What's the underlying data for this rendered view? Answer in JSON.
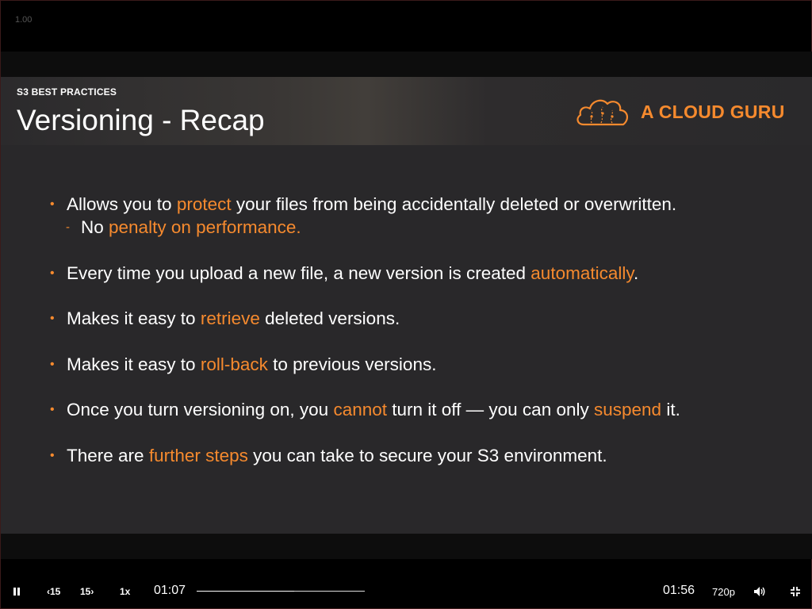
{
  "player": {
    "zoom_level": "1.00"
  },
  "slide": {
    "section_label": "S3 BEST PRACTICES",
    "title": "Versioning - Recap",
    "logo_text": "A CLOUD GURU",
    "bullets": [
      {
        "parts": [
          "Allows you to ",
          "protect",
          " your files from being accidentally deleted or overwritten."
        ],
        "sub": {
          "parts": [
            "No",
            " penalty on performance."
          ]
        }
      },
      {
        "parts": [
          "Every time you upload a new file, a new version is created ",
          "automatically",
          "."
        ]
      },
      {
        "parts": [
          "Makes it easy to ",
          "retrieve",
          " deleted versions."
        ]
      },
      {
        "parts": [
          "Makes it easy to ",
          "roll-back",
          " to previous versions."
        ]
      },
      {
        "parts": [
          "Once you turn versioning on, you ",
          "cannot",
          " turn it off — you can only ",
          "suspend",
          " it."
        ]
      },
      {
        "parts": [
          "There are ",
          "further steps",
          " you can take to secure your S3 environment."
        ]
      }
    ],
    "accent_color": "#f68a2e"
  },
  "controls": {
    "back_label": "15",
    "forward_label": "15",
    "speed_label": "1x",
    "current_time": "01:07",
    "total_time": "01:56",
    "quality_label": "720p",
    "progress": 0.58,
    "icons": [
      "pause-icon",
      "rewind-15-icon",
      "forward-15-icon",
      "volume-icon",
      "exit-fullscreen-icon"
    ]
  }
}
